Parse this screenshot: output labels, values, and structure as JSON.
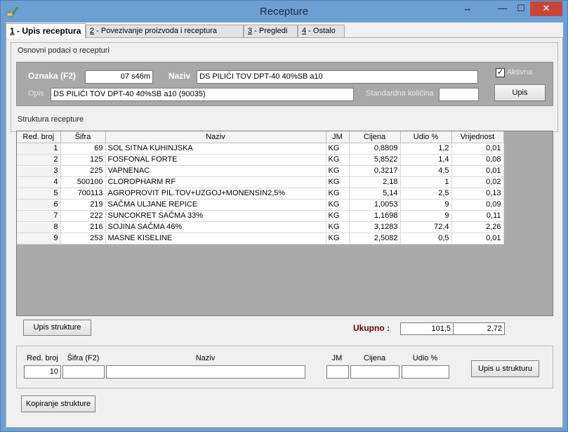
{
  "window": {
    "title": "Recepture",
    "restore_glyph": "↔",
    "minimize_glyph": "—",
    "maximize_glyph": "☐",
    "close_glyph": "✕"
  },
  "tabs": [
    {
      "key": "1",
      "label": " - Upis receptura"
    },
    {
      "key": "2",
      "label": " - Povezivanje proizvoda i receptura"
    },
    {
      "key": "3",
      "label": " - Pregledi"
    },
    {
      "key": "4",
      "label": " - Ostalo"
    }
  ],
  "basic": {
    "section_title": "Osnovni podaci o recepturi",
    "oznaka_label": "Oznaka (F2)",
    "oznaka_value": "07 s46m",
    "naziv_label": "Naziv",
    "naziv_value": "DS PILIĆI TOV DPT-40 40%SB a10",
    "opis_label": "Opis",
    "opis_value": "DS PILIĆI TOV DPT-40 40%SB a10 (90035)",
    "std_label": "Standardna količina",
    "std_value": "",
    "aktivna_label": "Aktivna",
    "aktivna_checked": "✓",
    "upis_label": "Upis"
  },
  "structure": {
    "section_title": "Struktura recepture",
    "columns": [
      "Red. broj",
      "Šifra",
      "Naziv",
      "JM",
      "Cijena",
      "Udio %",
      "Vrijednost"
    ],
    "rows": [
      [
        "1",
        "69",
        "SOL SITNA KUHINJSKA",
        "KG",
        "0,8809",
        "1,2",
        "0,01"
      ],
      [
        "2",
        "125",
        "FOSFONAL FORTE",
        "KG",
        "5,8522",
        "1,4",
        "0,08"
      ],
      [
        "3",
        "225",
        "VAPNENAC",
        "KG",
        "0,3217",
        "4,5",
        "0,01"
      ],
      [
        "4",
        "500100",
        "CLOROPHARM      RF",
        "KG",
        "2,18",
        "1",
        "0,02"
      ],
      [
        "5",
        "700113",
        "AGROPROVIT PIL.TOV+UZGOJ+MONENSIN2,5%",
        "KG",
        "5,14",
        "2,5",
        "0,13"
      ],
      [
        "6",
        "219",
        "SAČMA ULJANE REPICE",
        "KG",
        "1,0053",
        "9",
        "0,09"
      ],
      [
        "7",
        "222",
        "SUNCOKRET SAČMA  33%",
        "KG",
        "1,1698",
        "9",
        "0,11"
      ],
      [
        "8",
        "216",
        "SOJINA SAČMA  46%",
        "KG",
        "3,1283",
        "72,4",
        "2,26"
      ],
      [
        "9",
        "253",
        "MASNE KISELINE",
        "KG",
        "2,5082",
        "0,5",
        "0,01"
      ]
    ],
    "upis_strukture_label": "Upis strukture",
    "ukupno_label": "Ukupno :",
    "ukupno_udio": "101,5",
    "ukupno_vrijednost": "2,72"
  },
  "entry": {
    "labels": {
      "red_broj": "Red. broj",
      "sifra": "Šifra (F2)",
      "naziv": "Naziv",
      "jm": "JM",
      "cijena": "Cijena",
      "udio": "Udio %"
    },
    "red_broj_value": "10",
    "upis_u_strukturu_label": "Upis u strukturu"
  },
  "kopiranje_label": "Kopiranje strukture",
  "colors": {
    "titlebar": "#6d9fd2",
    "close": "#c7463b",
    "panel": "#a8a8a8",
    "ukupno": "#6b0000"
  }
}
